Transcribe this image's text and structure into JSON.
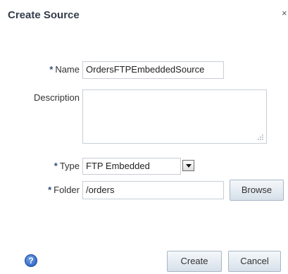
{
  "dialog": {
    "title": "Create Source",
    "close_label": "×"
  },
  "form": {
    "required_marker": "*",
    "name": {
      "label": "Name",
      "value": "OrdersFTPEmbeddedSource"
    },
    "description": {
      "label": "Description",
      "value": ""
    },
    "type": {
      "label": "Type",
      "selected": "FTP Embedded"
    },
    "folder": {
      "label": "Folder",
      "value": "/orders",
      "browse_label": "Browse"
    }
  },
  "footer": {
    "help_label": "?",
    "create_label": "Create",
    "cancel_label": "Cancel"
  },
  "colors": {
    "title": "#333c4a",
    "required": "#33507a",
    "input_border": "#c8ced6",
    "button_border": "#a9b6c6",
    "help_icon": "#2458b8"
  },
  "icons": {
    "help": "help-icon",
    "close": "close-icon",
    "dropdown": "chevron-down-icon",
    "resize": "resize-grip-icon"
  }
}
